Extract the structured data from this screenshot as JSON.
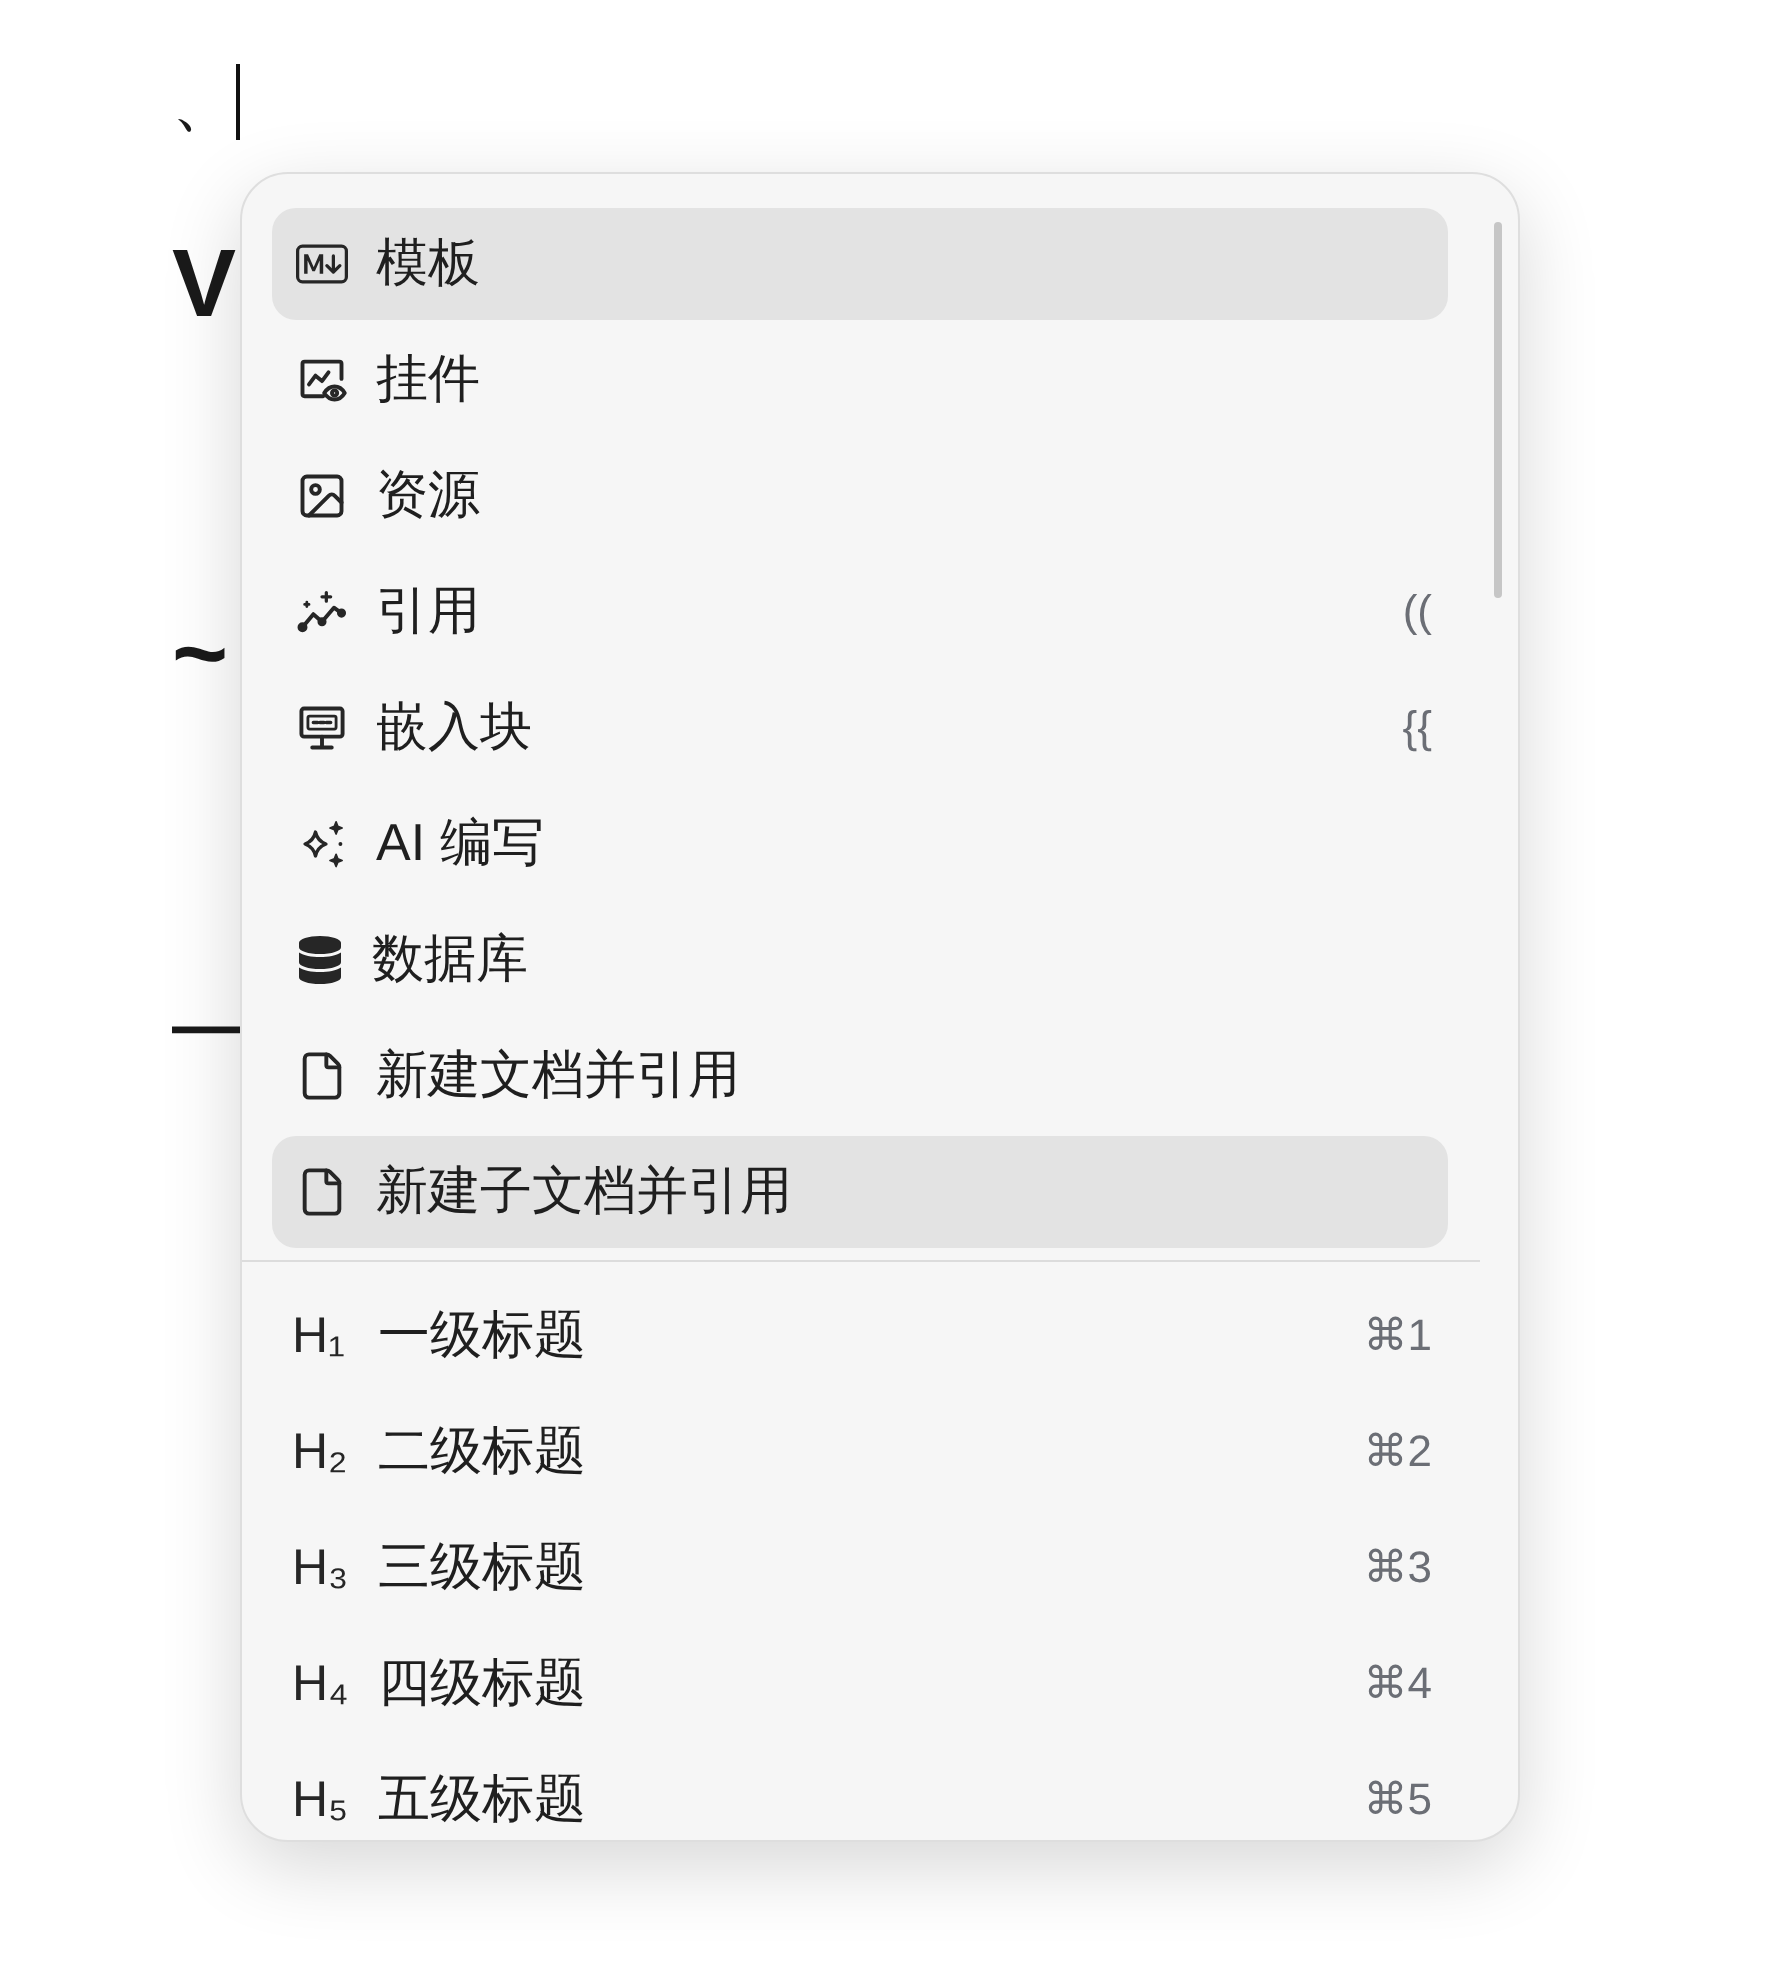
{
  "editor": {
    "lines": [
      {
        "kind": "text",
        "text": "、",
        "cursor": true
      },
      {
        "kind": "title",
        "text": "V",
        "cursor": false
      },
      {
        "kind": "title",
        "text": "~",
        "cursor": false
      },
      {
        "kind": "symbol",
        "text": "—",
        "cursor": false
      }
    ]
  },
  "slash_menu": {
    "blocks": [
      {
        "label": "模板",
        "selected": true
      },
      {
        "label": "挂件",
        "selected": false
      },
      {
        "label": "资源",
        "selected": false
      },
      {
        "label": "引用",
        "shortcut": "((",
        "selected": false
      },
      {
        "label": "嵌入块",
        "shortcut": "{{",
        "selected": false
      },
      {
        "label": "AI 编写",
        "selected": false
      },
      {
        "label": "数据库",
        "selected": false
      },
      {
        "label": "新建文档并引用",
        "selected": false
      },
      {
        "label": "新建子文档并引用",
        "selected": true
      }
    ],
    "headings": [
      {
        "marker": "H₁",
        "label": "一级标题",
        "shortcut": "⌘1",
        "selected": false
      },
      {
        "marker": "H₂",
        "label": "二级标题",
        "shortcut": "⌘2",
        "selected": false
      },
      {
        "marker": "H₃",
        "label": "三级标题",
        "shortcut": "⌘3",
        "selected": false
      },
      {
        "marker": "H₄",
        "label": "四级标题",
        "shortcut": "⌘4",
        "selected": false
      },
      {
        "marker": "H₅",
        "label": "五级标题",
        "shortcut": "⌘5",
        "selected": false
      }
    ]
  }
}
